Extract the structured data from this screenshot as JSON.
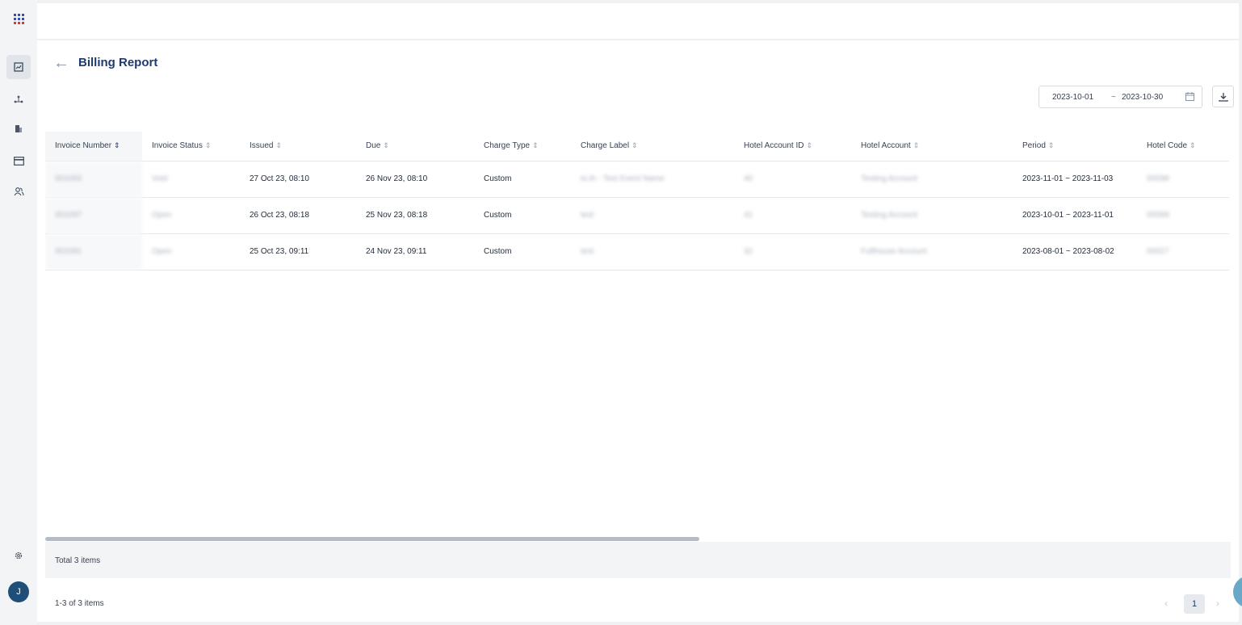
{
  "page": {
    "title": "Billing Report"
  },
  "sidebar": {
    "avatar_initial": "J",
    "items": [
      {
        "icon": "apps-grid-icon"
      },
      {
        "icon": "report-chart-icon",
        "active": true
      },
      {
        "icon": "network-icon"
      },
      {
        "icon": "building-icon"
      },
      {
        "icon": "credit-card-icon"
      },
      {
        "icon": "users-icon"
      },
      {
        "icon": "settings-gear-icon"
      }
    ]
  },
  "filters": {
    "start_date": "2023-10-01",
    "separator": "~",
    "end_date": "2023-10-30"
  },
  "table": {
    "columns": [
      "Invoice Number",
      "Invoice Status",
      "Issued",
      "Due",
      "Charge Type",
      "Charge Label",
      "Hotel Account ID",
      "Hotel Account",
      "Period",
      "Hotel Code"
    ],
    "rows": [
      {
        "invoice_number": "001093",
        "invoice_status": "Void",
        "issued": "27 Oct 23, 08:10",
        "due": "26 Nov 23, 08:10",
        "charge_type": "Custom",
        "charge_label": "ts.th - Test Event Name",
        "hotel_account_id": "40",
        "hotel_account": "Testing Account",
        "period": "2023-11-01 ~ 2023-11-03",
        "hotel_code": "00098"
      },
      {
        "invoice_number": "001097",
        "invoice_status": "Open",
        "issued": "26 Oct 23, 08:18",
        "due": "25 Nov 23, 08:18",
        "charge_type": "Custom",
        "charge_label": "test",
        "hotel_account_id": "41",
        "hotel_account": "Testing Account",
        "period": "2023-10-01 ~ 2023-11-01",
        "hotel_code": "00098"
      },
      {
        "invoice_number": "001091",
        "invoice_status": "Open",
        "issued": "25 Oct 23, 09:11",
        "due": "24 Nov 23, 09:11",
        "charge_type": "Custom",
        "charge_label": "test",
        "hotel_account_id": "32",
        "hotel_account": "Fullhouse Account",
        "period": "2023-08-01 ~ 2023-08-02",
        "hotel_code": "00027"
      }
    ]
  },
  "footer": {
    "total_text": "Total 3 items",
    "range_text": "1-3 of 3 items",
    "current_page": "1"
  }
}
